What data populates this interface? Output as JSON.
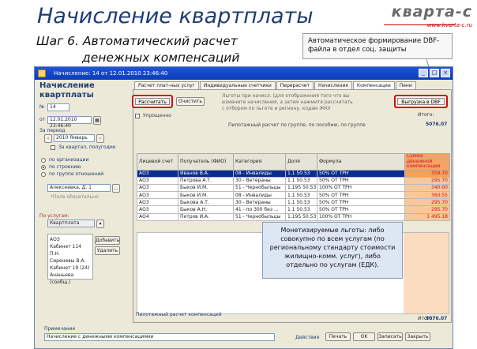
{
  "slide": {
    "title": "Начисление квартплаты",
    "subtitle_l1": "Шаг 6.  Автоматический расчет",
    "subtitle_l2": "денежных компенсаций",
    "logo": "кварта-с",
    "logo_sub": "www.kvarta-c.ru",
    "callout_top": "Автоматическое формирование DBF-файла в отдел соц. защиты",
    "callout_bottom": "Монетизируемые льготы: либо совокупно по всем услугам (по региональному стандарту стоимости жилищно-комм. услуг), либо отдельно по услугам (ЕДК)."
  },
  "window": {
    "title": "Начисление: 14 от 12.01.2010 23:46:40",
    "btn_min": "_",
    "btn_max": "□",
    "btn_close": "×"
  },
  "left": {
    "header": "Начисление квартплаты",
    "no_label": "№",
    "no_value": "14",
    "from_label": "от",
    "from_value": "12.01.2010 23:46:40",
    "period_label": "За период",
    "month_value": "2010 Январь",
    "check_label": "За квартал, полугодие",
    "radio1": "по организации",
    "radio2": "по строению",
    "radio3": "по группе отношений",
    "building_value": "Алексеевка, Д. 1",
    "hint": "*Поле обязательно",
    "services_label": "По услугам:",
    "services_value": "Квартплата",
    "box_lines": [
      "АОЗ",
      "Кабинет 114 П.Н.",
      "Сиреневы В.А.",
      "Кабинет 19 (24)",
      "Ананьева (сообщ.)"
    ],
    "btn_add": "Добавить",
    "btn_del": "Удалить"
  },
  "tabs": [
    "Расчет плат-ных услуг",
    "Индивидуальные счетчики",
    "Перерасчет",
    "Начисления",
    "Компенсации",
    "Пени"
  ],
  "content": {
    "btn_calc": "Рассчитать",
    "btn_clear": "Очистить",
    "msg1": "Льготы при начисл. (для отображения того что вы",
    "msg2": "измените начисления, а затем нажмите рассчитать",
    "msg3": "с отбором по льготе и региону, кодам ЖКУ",
    "check_label": "Упрощенно",
    "btn_dbf": "Выгрузка в DBF",
    "total_label": "Итого:",
    "total_value": "5076.07",
    "filter_label": "Пилотажный расчет по группе, по пособию, по группе",
    "columns": [
      "Лицевой счет",
      "Получатель (ФИО)",
      "Категория",
      "Доля",
      "Формула",
      "Сумма денежной компенсации"
    ],
    "rows": [
      [
        "АО3",
        "Иванов В.А.",
        "08 - Инвалиды",
        "1.1 50.53",
        "50% ОТ ТРН",
        "359.70"
      ],
      [
        "АО3",
        "Петрова А.Т.",
        "30 - Ветераны",
        "1.1 50.53",
        "50% ОТ ТРН",
        "295.70"
      ],
      [
        "АО3",
        "Быков И.М.",
        "51 - Чернобыльцы",
        "1.195 50.53",
        "100% ОТ ТРН",
        "340.00"
      ],
      [
        "АО3",
        "Быков И.М.",
        "08 - Инвалиды",
        "1.1 50.53",
        "50% ОТ ТРН",
        "360.55"
      ],
      [
        "АО3",
        "Быкова А.Т.",
        "30 - Ветераны",
        "1.1 50.53",
        "50% ОТ ТРН",
        "295.70"
      ],
      [
        "АО3",
        "Быков А.Н.",
        "41 - по 300 без ...",
        "1.1 50.53",
        "50% ОТ ТРН",
        "295.70"
      ],
      [
        "АО4",
        "Петров И.А.",
        "51 - Чернобыльцы",
        "1.195 50.53",
        "100% ОТ ТРН",
        "1 495.18"
      ]
    ],
    "total2_label": "Итого:",
    "total2_value": "5076.07"
  },
  "bottom": {
    "status_label": "Пилотажный расчет компенсаций",
    "note_label": "Примечание",
    "note_value": "Начисление с денежными компенсациями",
    "actions": "Действия",
    "btn_print": "Печать",
    "btn_ok": "OK",
    "btn_save": "Записать",
    "btn_close": "Закрыть"
  }
}
